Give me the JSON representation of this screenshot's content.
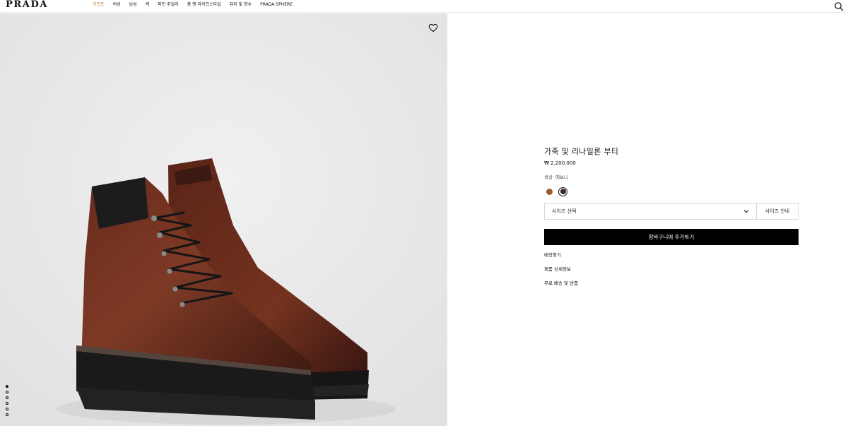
{
  "header": {
    "logo": "PRADA",
    "nav": [
      "기프트",
      "여성",
      "남성",
      "백",
      "파인 주얼리",
      "홈 앤 라이프스타일",
      "뷰티 및 향수",
      "PRADA SPHERE"
    ],
    "search_icon": "search-icon"
  },
  "gallery": {
    "wishlist_icon": "heart-icon",
    "image_count": 6,
    "active_index": 0
  },
  "product": {
    "title": "가죽 및 리나일론 부티",
    "price": "₩ 2,200,000",
    "color_label": "색상",
    "color_value": "에보니",
    "swatches": [
      {
        "name": "brown",
        "color": "#9e5b2f",
        "selected": false
      },
      {
        "name": "ebony",
        "color": "#3b2a22",
        "selected": true
      }
    ],
    "size_placeholder": "사이즈 선택",
    "size_guide": "사이즈 안내",
    "add_to_cart": "장바구니에 추가하기",
    "links": [
      "매장찾기",
      "제품 상세정보",
      "무료 배송 및 반품"
    ]
  }
}
